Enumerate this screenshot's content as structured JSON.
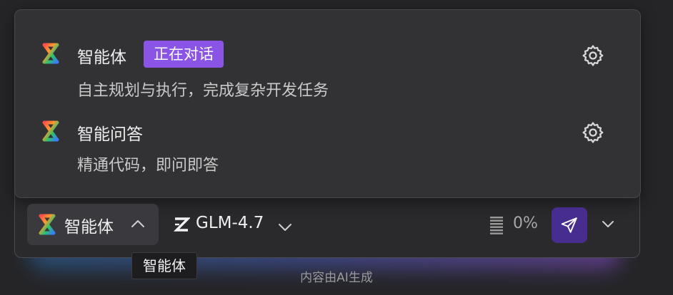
{
  "popup": {
    "options": [
      {
        "title": "智能体",
        "badge": "正在对话",
        "description": "自主规划与执行，完成复杂开发任务",
        "icon": "agent-logo-icon",
        "settings_icon": "gear-icon"
      },
      {
        "title": "智能问答",
        "description": "精通代码，即问即答",
        "icon": "agent-logo-icon",
        "settings_icon": "gear-icon"
      }
    ]
  },
  "toolbar": {
    "mode_label": "智能体",
    "model_label": "GLM-4.7",
    "context_usage": "0%",
    "send_icon": "send-icon",
    "more_icon": "chevron-down-icon"
  },
  "tooltip": {
    "text": "智能体"
  },
  "footer": {
    "note": "内容由AI生成"
  },
  "colors": {
    "badge": "#8a55e6",
    "send_button": "#472d8f",
    "background": "#252528"
  }
}
